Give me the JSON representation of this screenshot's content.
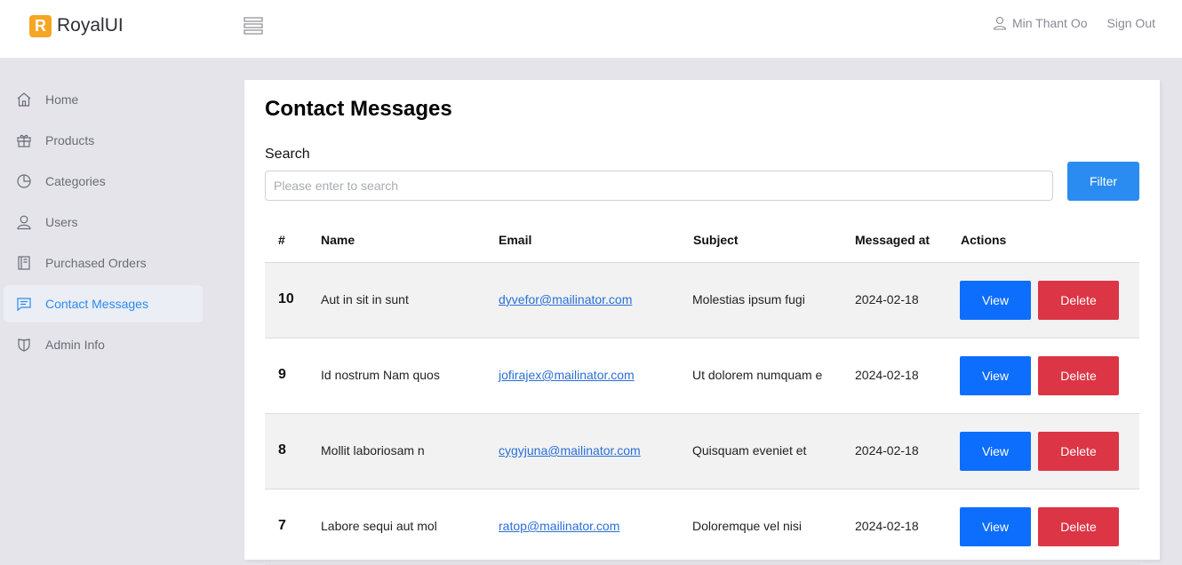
{
  "brand": {
    "logo_letter": "R",
    "name": "RoyalUI",
    "logo_color": "#f5a623"
  },
  "header": {
    "menu_icon": "hamburger-icon",
    "user_icon": "user-outline-icon",
    "user_name": "Min Thant Oo",
    "sign_out": "Sign Out"
  },
  "sidebar": {
    "items": [
      {
        "label": "Home",
        "icon": "home-icon"
      },
      {
        "label": "Products",
        "icon": "gift-icon"
      },
      {
        "label": "Categories",
        "icon": "pie-chart-icon"
      },
      {
        "label": "Users",
        "icon": "user-icon"
      },
      {
        "label": "Purchased Orders",
        "icon": "book-icon"
      },
      {
        "label": "Contact Messages",
        "icon": "message-icon",
        "active": true
      },
      {
        "label": "Admin Info",
        "icon": "shield-icon"
      }
    ]
  },
  "main": {
    "title": "Contact Messages",
    "search": {
      "label": "Search",
      "placeholder": "Please enter to search",
      "value": ""
    },
    "filter_label": "Filter",
    "table": {
      "headers": [
        "#",
        "Name",
        "Email",
        "Subject",
        "Messaged at",
        "Actions"
      ],
      "rows": [
        {
          "id": "10",
          "name": "Aut in sit in sunt",
          "email": "dyvefor@mailinator.com",
          "subject": "Molestias ipsum fugi",
          "date": "2024-02-18"
        },
        {
          "id": "9",
          "name": "Id nostrum Nam quos",
          "email": "jofirajex@mailinator.com",
          "subject": "Ut dolorem numquam e",
          "date": "2024-02-18"
        },
        {
          "id": "8",
          "name": "Mollit laboriosam n",
          "email": "cygyjuna@mailinator.com",
          "subject": "Quisquam eveniet et",
          "date": "2024-02-18"
        },
        {
          "id": "7",
          "name": "Labore sequi aut mol",
          "email": "ratop@mailinator.com",
          "subject": "Doloremque vel nisi",
          "date": "2024-02-18"
        }
      ],
      "view_label": "View",
      "delete_label": "Delete"
    }
  },
  "colors": {
    "accent": "#2a8cf0",
    "view_button": "#0d6efd",
    "delete_button": "#dc3545",
    "background": "#e4e4ea"
  }
}
